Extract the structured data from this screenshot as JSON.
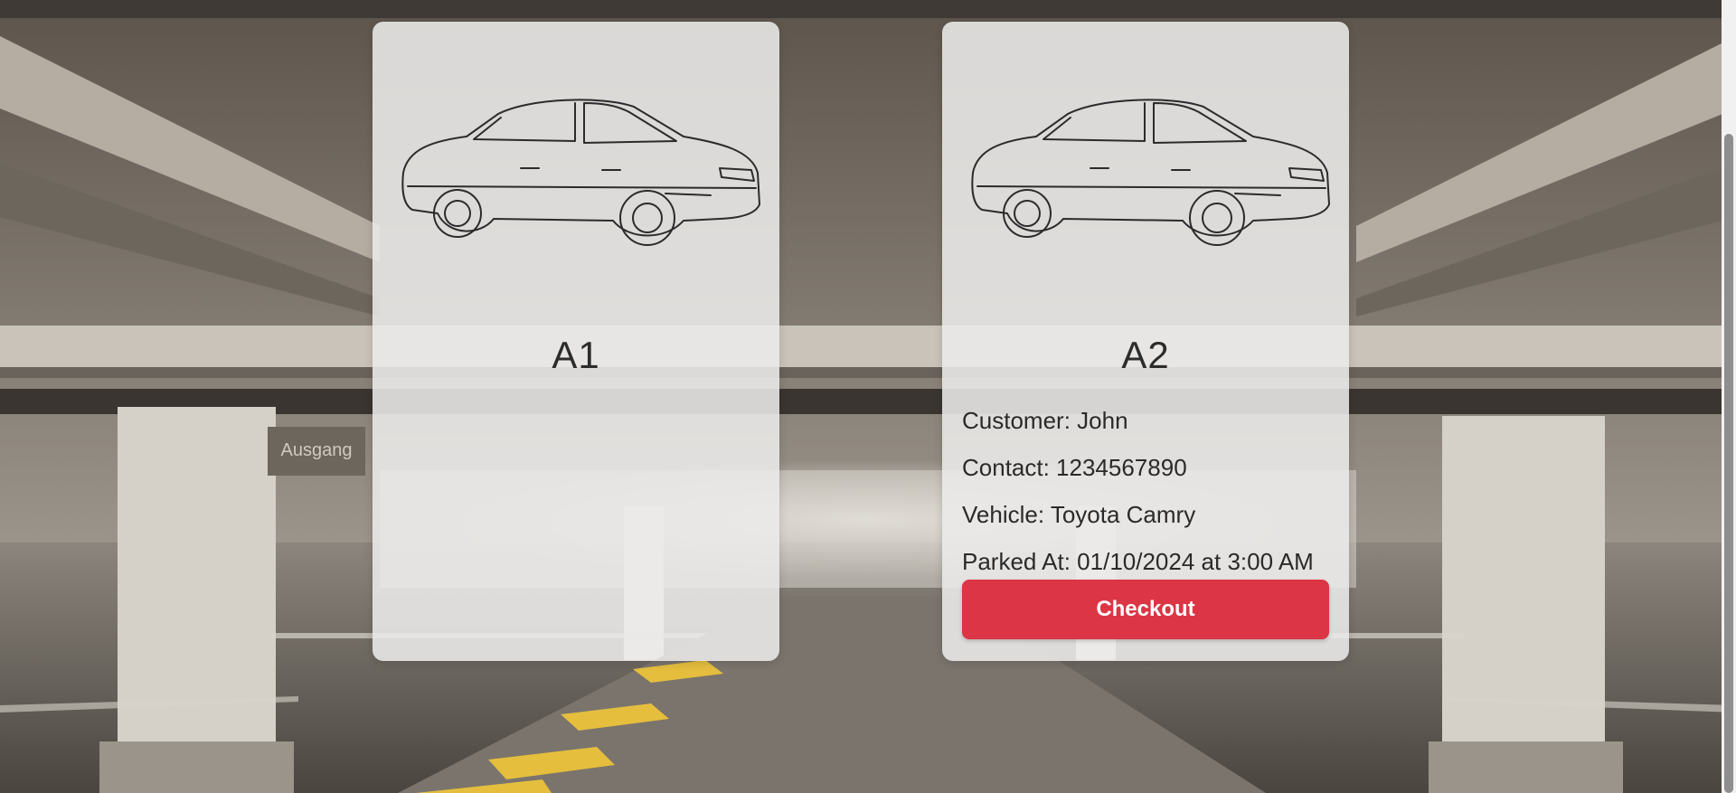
{
  "slots": [
    {
      "label": "A1",
      "occupied": false,
      "image_icon": "car-outline-icon"
    },
    {
      "label": "A2",
      "occupied": true,
      "image_icon": "car-outline-icon",
      "customer_line": "Customer: John",
      "contact_line": "Contact: 1234567890",
      "vehicle_line": "Vehicle: Toyota Camry",
      "parked_line": "Parked At: 01/10/2024 at 3:00 AM",
      "checkout_label": "Checkout"
    }
  ],
  "background": {
    "sign_text": "Ausgang"
  },
  "colors": {
    "checkout_button": "#dc3545",
    "card_background": "#ecebe9"
  }
}
